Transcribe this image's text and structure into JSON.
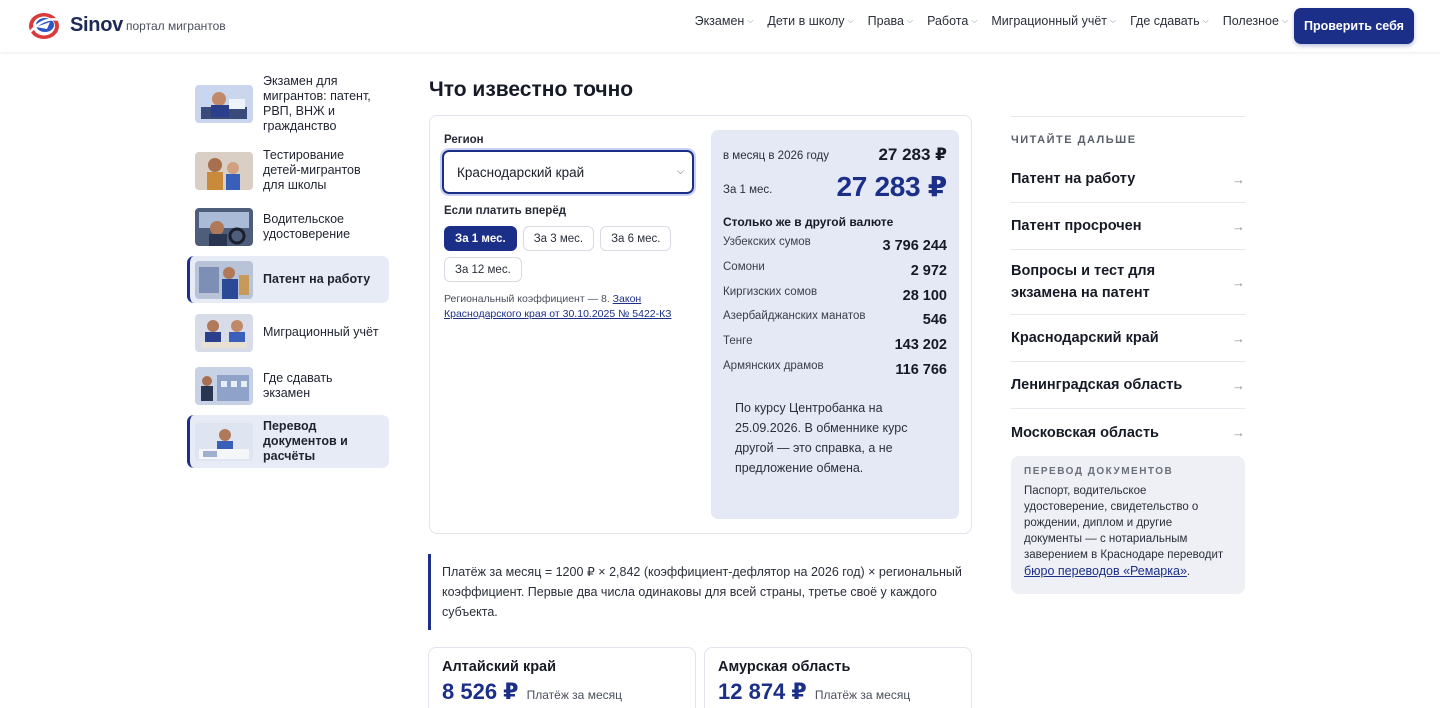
{
  "header": {
    "brand": "Sinov",
    "tagline": "портал мигрантов",
    "nav": [
      "Экзамен",
      "Дети в школу",
      "Права",
      "Работа",
      "Миграционный учёт",
      "Где сдавать",
      "Полезное"
    ],
    "cta": "Проверить себя"
  },
  "sidebar": {
    "items": [
      {
        "label": "Экзамен для мигрантов: патент, РВП, ВНЖ и гражданство"
      },
      {
        "label": "Тестирование детей-мигрантов для школы"
      },
      {
        "label": "Водительское удостоверение"
      },
      {
        "label": "Патент на работу"
      },
      {
        "label": "Миграционный учёт"
      },
      {
        "label": "Где сдавать экзамен"
      },
      {
        "label": "Перевод документов и расчёты"
      }
    ]
  },
  "main": {
    "title": "Что известно точно",
    "calculator": {
      "region_label": "Регион",
      "region_value": "Краснодарский край",
      "prepay_label": "Если платить вперёд",
      "periods": [
        "За 1 мес.",
        "За 3 мес.",
        "За 6 мес.",
        "За 12 мес."
      ],
      "coef_prefix": "Региональный коэффициент — 8.",
      "coef_link": "Закон Краснодарского края от 30.10.2025 № 5422-КЗ"
    },
    "result": {
      "per_month_label": "в месяц в 2026 году",
      "per_month_value": "27 283 ₽",
      "period_label": "За 1 мес.",
      "period_value": "27 283 ₽",
      "currency_title": "Столько же в другой валюте",
      "currencies": [
        {
          "name": "Узбекских сумов",
          "value": "3 796 244"
        },
        {
          "name": "Сомони",
          "value": "2 972"
        },
        {
          "name": "Киргизских сомов",
          "value": "28 100"
        },
        {
          "name": "Азербайджанских манатов",
          "value": "546"
        },
        {
          "name": "Тенге",
          "value": "143 202"
        },
        {
          "name": "Армянских драмов",
          "value": "116 766"
        }
      ],
      "note": "По курсу Центробанка на 25.09.2026. В обменнике курс другой — это справка, а не предложение обмена."
    },
    "formula": "Платёж за месяц = 1200 ₽ × 2,842 (коэффициент-дефлятор на 2026 год) × региональный коэффициент. Первые два числа одинаковы для всей страны, третье своё у каждого субъекта.",
    "region_cards": [
      {
        "title": "Алтайский край",
        "value": "8 526 ₽",
        "sub": "Платёж за месяц"
      },
      {
        "title": "Амурская область",
        "value": "12 874 ₽",
        "sub": "Платёж за месяц"
      }
    ]
  },
  "right": {
    "read_more_label": "ЧИТАЙТЕ ДАЛЬШЕ",
    "links": [
      "Патент на работу",
      "Патент просрочен",
      "Вопросы и тест для экзамена на патент",
      "Краснодарский край",
      "Ленинградская область",
      "Московская область"
    ],
    "ad": {
      "label": "ПЕРЕВОД ДОКУМЕНТОВ",
      "text": "Паспорт, водительское удостоверение, свидетельство о рождении, диплом и другие документы — с нотариальным заверением в Краснодаре переводит",
      "link": "бюро переводов «Ремарка»",
      "suffix": "."
    }
  },
  "colors": {
    "accent": "#1c2f88",
    "panel": "#e5e9f6"
  }
}
